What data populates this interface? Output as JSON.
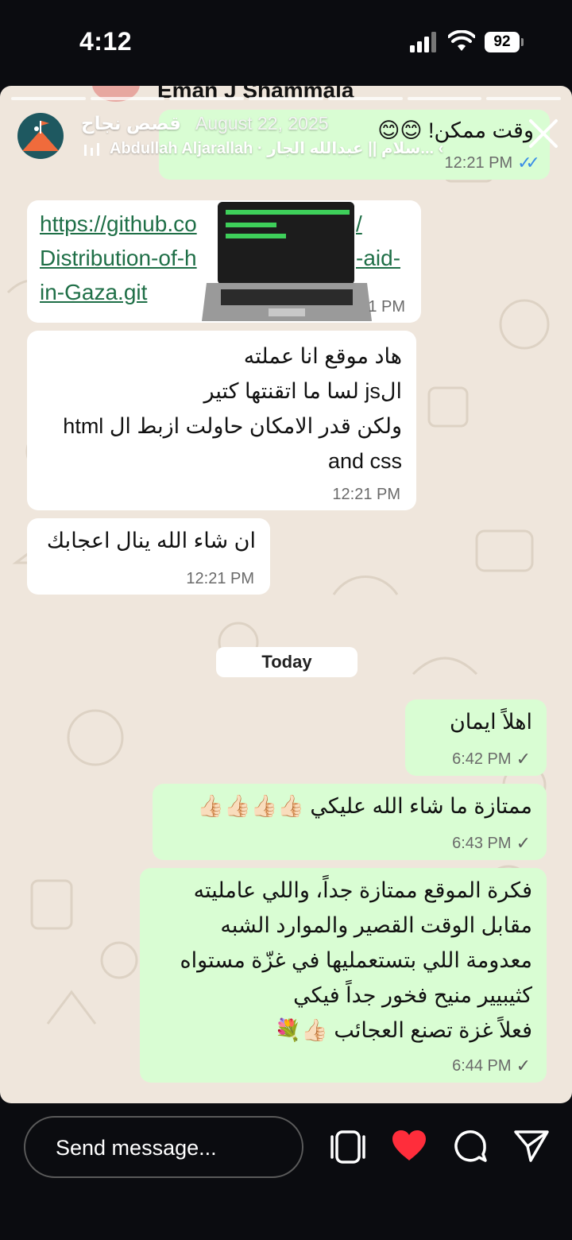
{
  "status_bar": {
    "time": "4:12",
    "battery": "92"
  },
  "chat": {
    "contact_name": "Eman J Shammala",
    "partial_top_message": {
      "text": "وقت ممكن! 😊😊",
      "time": "12:21 PM",
      "ticks": "✓✓"
    },
    "link_message": {
      "lines": [
        "https://github.co",
        "Distribution-of-h",
        "in-Gaza.git"
      ],
      "lines_right": [
        "/",
        "-aid-"
      ],
      "time": "1 PM"
    },
    "messages_in": [
      {
        "lines": [
          "هاد موقع انا عملته",
          "الjs لسا ما اتقنتها كتير",
          "ولكن قدر الامكان حاولت ازبط ال html",
          "and css"
        ],
        "time": "12:21 PM"
      },
      {
        "lines": [
          "ان شاء الله ينال اعجابك"
        ],
        "time": "12:21 PM"
      }
    ],
    "date_separator": "Today",
    "messages_out": [
      {
        "lines": [
          "اهلاً ايمان"
        ],
        "time": "6:42 PM",
        "ticks": "✓"
      },
      {
        "lines": [
          "ممتازة ما شاء الله عليكي 👍🏻👍🏻👍🏻👍🏻"
        ],
        "time": "6:43 PM",
        "ticks": "✓"
      },
      {
        "lines": [
          "فكرة الموقع ممتازة جداً، واللي عامليته",
          "مقابل الوقت القصير والموارد الشبه",
          "معدومة اللي بتستعمليها في غزّة مستواه",
          "كثيبيير منيح فخور جداً فيكي",
          "فعلاً غزة تصنع العجائب 👍🏻💐"
        ],
        "time": "6:44 PM",
        "ticks": "✓"
      }
    ]
  },
  "story": {
    "user": "قصص نجاح",
    "date": "August 22, 2025",
    "music": "Abdullah Aljarallah · سلام || عبدالله الجار... ‹"
  },
  "bottom_bar": {
    "send_placeholder": "Send message..."
  },
  "colors": {
    "incoming": "#ffffff",
    "outgoing": "#d9fdd3",
    "link": "#1f6f47",
    "heart": "#ff2d3b",
    "read_ticks": "#3a8ee6"
  }
}
